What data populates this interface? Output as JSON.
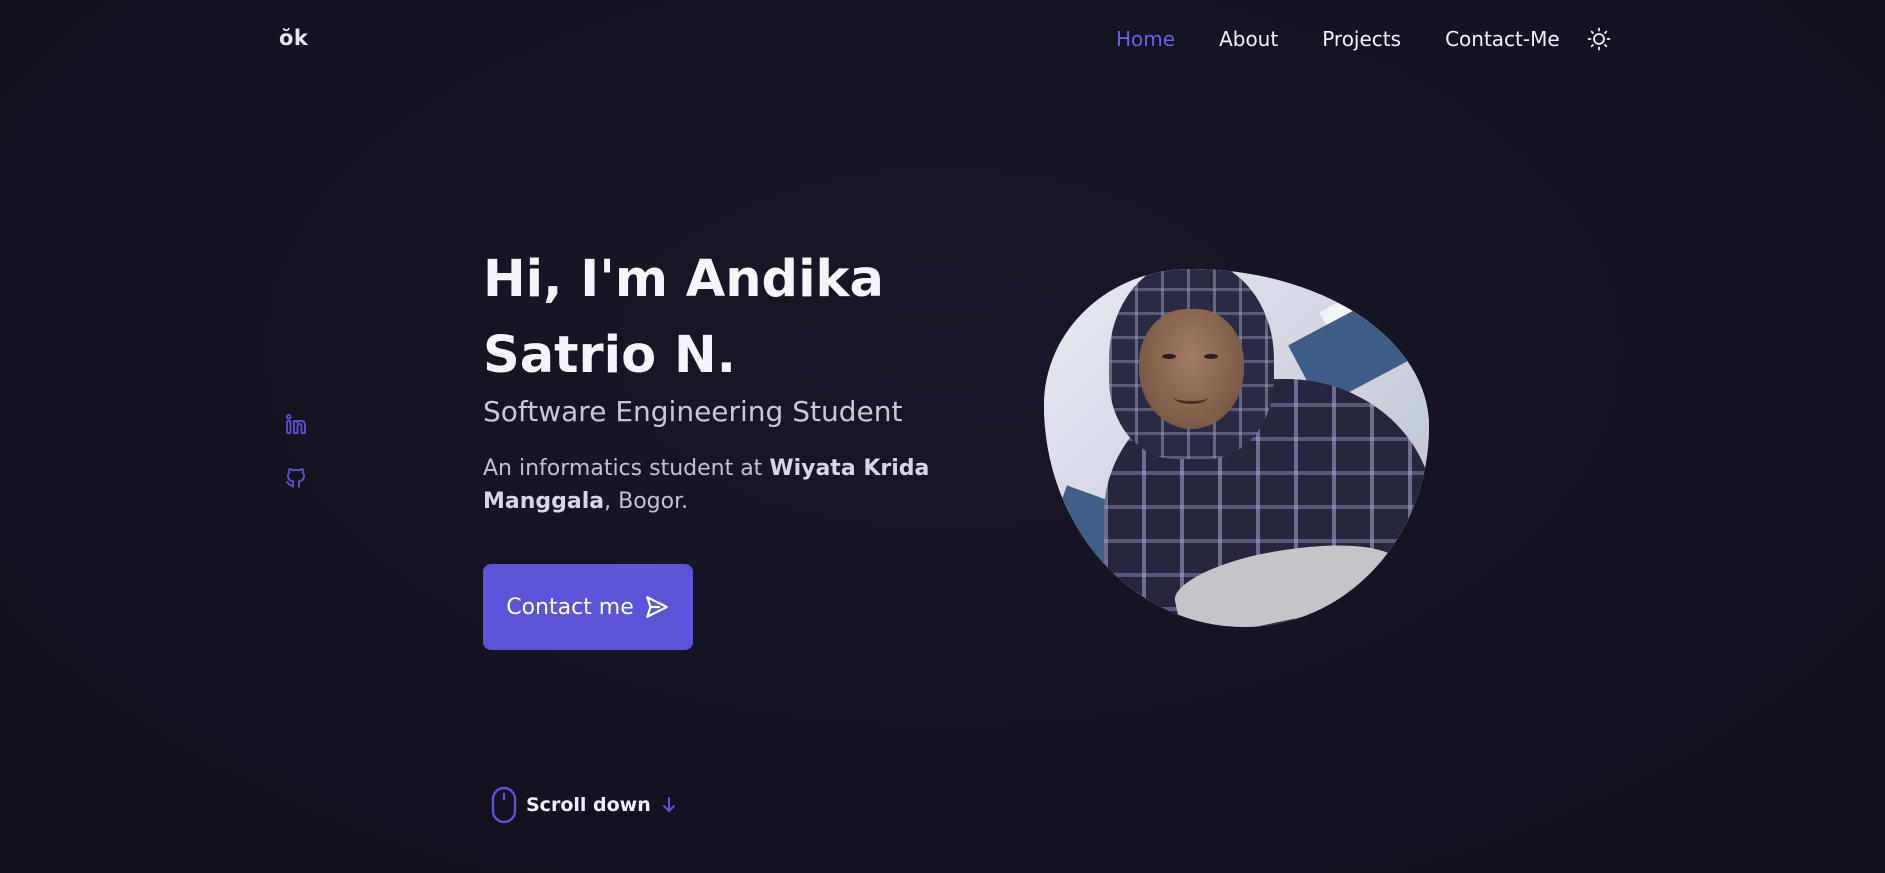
{
  "header": {
    "logo": "ŏk",
    "nav": [
      {
        "label": "Home",
        "active": true
      },
      {
        "label": "About",
        "active": false
      },
      {
        "label": "Projects",
        "active": false
      },
      {
        "label": "Contact-Me",
        "active": false
      }
    ],
    "theme_icon": "sun-icon"
  },
  "social": [
    {
      "icon": "linkedin-icon"
    },
    {
      "icon": "github-icon"
    }
  ],
  "hero": {
    "title": "Hi, I'm Andika Satrio N.",
    "subtitle": "Software Engineering Student",
    "description_prefix": "An informatics student at ",
    "description_bold": "Wiyata Krida Manggala",
    "description_suffix": ", Bogor.",
    "cta_label": "Contact me",
    "cta_icon": "send-icon"
  },
  "scroll": {
    "label": "Scroll down",
    "mouse_icon": "mouse-icon",
    "arrow_icon": "arrow-down-icon"
  },
  "colors": {
    "accent": "#5b54d8",
    "background": "#15141f",
    "active_nav": "#6a63e3"
  }
}
